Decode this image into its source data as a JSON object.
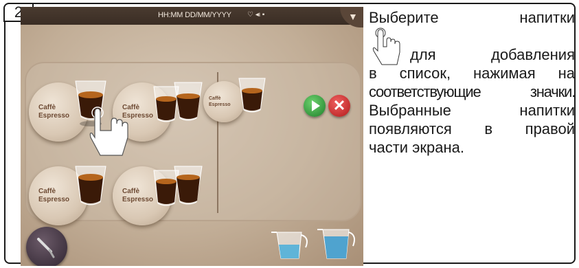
{
  "step_number": "2",
  "status_bar": {
    "time_date": "HH:MM DD/MM/YYYY",
    "icons": [
      "wifi-icon",
      "speaker-icon",
      "lock-icon"
    ]
  },
  "beverages": [
    {
      "line1": "Caffè",
      "line2": "Espresso",
      "cup": "single"
    },
    {
      "line1": "Caffè",
      "line2": "Espresso",
      "cup": "double"
    },
    {
      "line1": "Caffè",
      "line2": "Espresso",
      "cup": "single"
    },
    {
      "line1": "Caffè",
      "line2": "Espresso",
      "cup": "double"
    }
  ],
  "selected_list": [
    {
      "line1": "Caffè",
      "line2": "Espresso"
    }
  ],
  "instruction": {
    "line1": "Выберите напитки",
    "line2": "для добавления",
    "line3": "в список, нажимая на",
    "line4": "соответствующие значки.",
    "line5": "Выбранные напитки",
    "line6": "появляются в правой",
    "line7": "части экрана."
  },
  "colors": {
    "screen_bg": "#c9b8a3",
    "status_bar": "#3f3128",
    "play": "#2e9a3a",
    "cancel": "#d02a2a"
  }
}
